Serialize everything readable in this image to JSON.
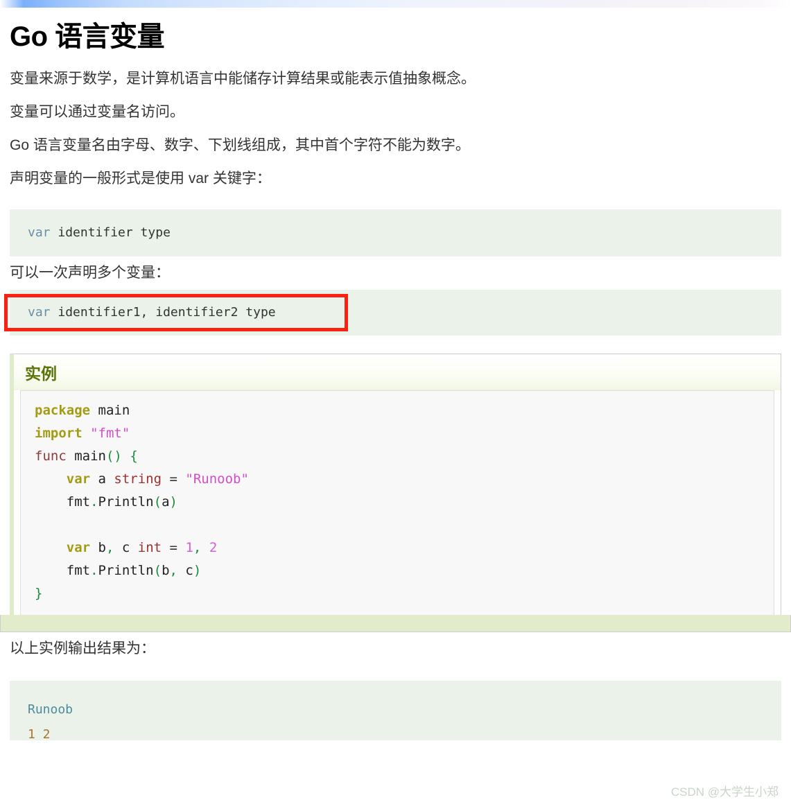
{
  "decor": {
    "top_strip_accent": "#7aaffb"
  },
  "article": {
    "title": "Go 语言变量",
    "paragraphs": [
      "变量来源于数学，是计算机语言中能储存计算结果或能表示值抽象概念。",
      "变量可以通过变量名访问。",
      "Go 语言变量名由字母、数字、下划线组成，其中首个字符不能为数字。",
      "声明变量的一般形式是使用 var 关键字："
    ],
    "paragraph_between_code": "可以一次声明多个变量：",
    "paragraph_output_intro": "以上实例输出结果为："
  },
  "syntax_block_1": {
    "keyword": "var",
    "rest": " identifier type",
    "bg_color": "#eaf2ea",
    "keyword_color": "#6b8ea6"
  },
  "syntax_block_2": {
    "keyword": "var",
    "rest": " identifier1, identifier2 type",
    "bg_color": "#eaf2ea",
    "keyword_color": "#6b8ea6",
    "annotation": {
      "shape": "rectangle",
      "color": "#fa2112",
      "thickness_px": 5
    }
  },
  "example_box": {
    "title": "实例",
    "title_color": "#5a7409",
    "footer_color": "#e2eccb",
    "code_lines": [
      {
        "tokens": [
          {
            "t": "package",
            "c": "t-kw"
          },
          {
            "t": " ",
            "c": "t-id"
          },
          {
            "t": "main",
            "c": "t-id"
          }
        ]
      },
      {
        "tokens": [
          {
            "t": "import",
            "c": "t-kw"
          },
          {
            "t": " ",
            "c": "t-id"
          },
          {
            "t": "\"fmt\"",
            "c": "t-str"
          }
        ]
      },
      {
        "tokens": [
          {
            "t": "func",
            "c": "t-fn"
          },
          {
            "t": " main",
            "c": "t-id"
          },
          {
            "t": "()",
            "c": "t-pn"
          },
          {
            "t": " ",
            "c": "t-id"
          },
          {
            "t": "{",
            "c": "t-pn"
          }
        ]
      },
      {
        "tokens": [
          {
            "t": "    ",
            "c": "t-id"
          },
          {
            "t": "var",
            "c": "t-kw"
          },
          {
            "t": " a ",
            "c": "t-id"
          },
          {
            "t": "string",
            "c": "t-type"
          },
          {
            "t": " ",
            "c": "t-id"
          },
          {
            "t": "=",
            "c": "t-op"
          },
          {
            "t": " ",
            "c": "t-id"
          },
          {
            "t": "\"Runoob\"",
            "c": "t-str"
          }
        ]
      },
      {
        "tokens": [
          {
            "t": "    fmt",
            "c": "t-id"
          },
          {
            "t": ".",
            "c": "t-pn"
          },
          {
            "t": "Println",
            "c": "t-id"
          },
          {
            "t": "(",
            "c": "t-pn"
          },
          {
            "t": "a",
            "c": "t-id"
          },
          {
            "t": ")",
            "c": "t-pn"
          }
        ]
      },
      {
        "tokens": [
          {
            "t": "",
            "c": "t-id"
          }
        ]
      },
      {
        "tokens": [
          {
            "t": "    ",
            "c": "t-id"
          },
          {
            "t": "var",
            "c": "t-kw"
          },
          {
            "t": " b",
            "c": "t-id"
          },
          {
            "t": ",",
            "c": "t-pn"
          },
          {
            "t": " c ",
            "c": "t-id"
          },
          {
            "t": "int",
            "c": "t-type"
          },
          {
            "t": " ",
            "c": "t-id"
          },
          {
            "t": "=",
            "c": "t-op"
          },
          {
            "t": " ",
            "c": "t-id"
          },
          {
            "t": "1",
            "c": "t-num"
          },
          {
            "t": ",",
            "c": "t-pn"
          },
          {
            "t": " ",
            "c": "t-id"
          },
          {
            "t": "2",
            "c": "t-num"
          }
        ]
      },
      {
        "tokens": [
          {
            "t": "    fmt",
            "c": "t-id"
          },
          {
            "t": ".",
            "c": "t-pn"
          },
          {
            "t": "Println",
            "c": "t-id"
          },
          {
            "t": "(",
            "c": "t-pn"
          },
          {
            "t": "b",
            "c": "t-id"
          },
          {
            "t": ",",
            "c": "t-pn"
          },
          {
            "t": " c",
            "c": "t-id"
          },
          {
            "t": ")",
            "c": "t-pn"
          }
        ]
      },
      {
        "tokens": [
          {
            "t": "}",
            "c": "t-pn"
          }
        ]
      }
    ]
  },
  "output_block": {
    "bg_color": "#eaf2ea",
    "lines": [
      {
        "text": "Runoob",
        "cls": "out-str"
      },
      {
        "text": "1 2",
        "cls": "out-num"
      }
    ]
  },
  "watermark": {
    "text": "CSDN @大学生小郑"
  }
}
